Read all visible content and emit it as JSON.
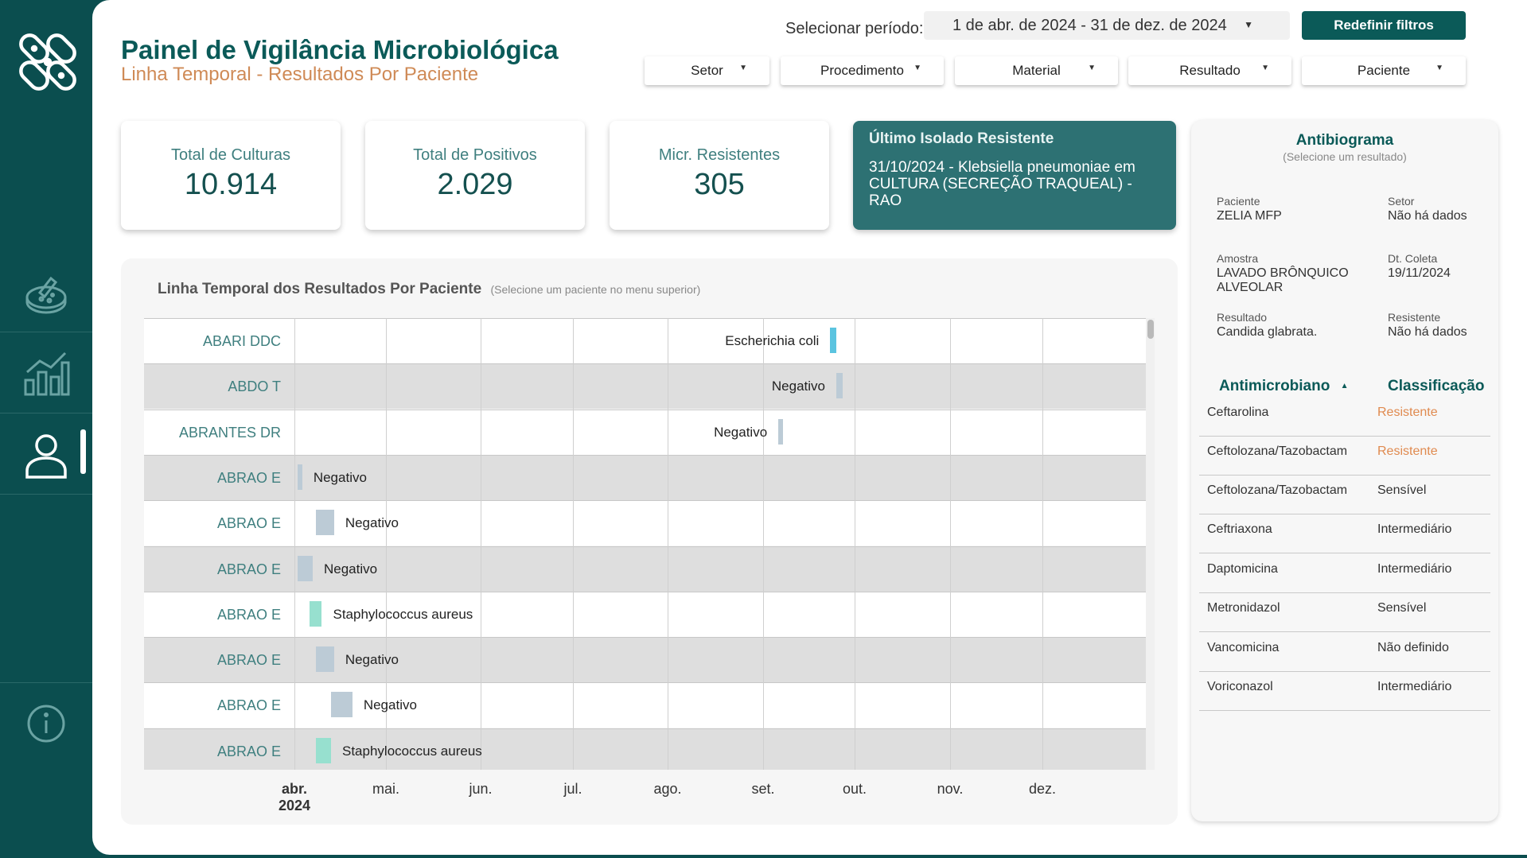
{
  "sidebar": {
    "logo_icon": "bacteria-icon",
    "nav": [
      {
        "name": "petri-dish-icon"
      },
      {
        "name": "chart-icon"
      },
      {
        "name": "user-icon",
        "active": true
      }
    ],
    "info_icon": "info-icon"
  },
  "header": {
    "title": "Painel de Vigilância Microbiológica",
    "subtitle": "Linha Temporal - Resultados Por Paciente",
    "period_label": "Selecionar período:",
    "period_value": "1 de abr. de 2024 - 31 de dez. de 2024",
    "reset_label": "Redefinir filtros",
    "filters": [
      "Setor",
      "Procedimento",
      "Material",
      "Resultado",
      "Paciente"
    ]
  },
  "kpis": [
    {
      "label": "Total de Culturas",
      "value": "10.914"
    },
    {
      "label": "Total de Positivos",
      "value": "2.029"
    },
    {
      "label": "Micr. Resistentes",
      "value": "305"
    }
  ],
  "last_isolate": {
    "title": "Último Isolado Resistente",
    "text": "31/10/2024 - Klebsiella pneumoniae em CULTURA (SECREÇÃO TRAQUEAL) - RAO"
  },
  "timeline": {
    "title": "Linha Temporal dos Resultados Por Paciente",
    "hint": "(Selecione um paciente no menu superior)",
    "months": [
      "abr.",
      "mai.",
      "jun.",
      "jul.",
      "ago.",
      "set.",
      "out.",
      "nov.",
      "dez."
    ],
    "year": "2024",
    "rows": [
      {
        "patient": "ABARI DDC",
        "result": "Escherichia coli",
        "start": "2024-09-23",
        "end": "2024-09-25",
        "color": "#5bc4e0"
      },
      {
        "patient": "ABDO T",
        "result": "Negativo",
        "start": "2024-09-25",
        "end": "2024-09-27",
        "color": "#bccbd6"
      },
      {
        "patient": "ABRANTES DR",
        "result": "Negativo",
        "start": "2024-09-06",
        "end": "2024-09-07",
        "color": "#bccbd6"
      },
      {
        "patient": "ABRAO E",
        "result": "Negativo",
        "start": "2024-04-02",
        "end": "2024-04-03",
        "color": "#bccbd6"
      },
      {
        "patient": "ABRAO E",
        "result": "Negativo",
        "start": "2024-04-08",
        "end": "2024-04-14",
        "color": "#bccbd6"
      },
      {
        "patient": "ABRAO E",
        "result": "Negativo",
        "start": "2024-04-02",
        "end": "2024-04-07",
        "color": "#bccbd6"
      },
      {
        "patient": "ABRAO E",
        "result": "Staphylococcus aureus",
        "start": "2024-04-06",
        "end": "2024-04-10",
        "color": "#97e0cf"
      },
      {
        "patient": "ABRAO E",
        "result": "Negativo",
        "start": "2024-04-08",
        "end": "2024-04-14",
        "color": "#bccbd6"
      },
      {
        "patient": "ABRAO E",
        "result": "Negativo",
        "start": "2024-04-13",
        "end": "2024-04-20",
        "color": "#bccbd6"
      },
      {
        "patient": "ABRAO E",
        "result": "Staphylococcus aureus",
        "start": "2024-04-08",
        "end": "2024-04-13",
        "color": "#97e0cf"
      }
    ]
  },
  "antibiogram": {
    "title": "Antibiograma",
    "subtitle": "(Selecione um resultado)",
    "fields": [
      {
        "key": "Paciente",
        "value": "ZELIA MFP"
      },
      {
        "key": "Setor",
        "value": "Não há dados"
      },
      {
        "key": "Amostra",
        "value": "LAVADO BRÔNQUICO ALVEOLAR"
      },
      {
        "key": "Dt. Coleta",
        "value": "19/11/2024"
      },
      {
        "key": "Resultado",
        "value": "Candida glabrata."
      },
      {
        "key": "Resistente",
        "value": "Não há dados"
      }
    ],
    "col_antimicrobial": "Antimicrobiano",
    "col_class": "Classificação",
    "resistant_color": "#e08a4f",
    "rows": [
      {
        "name": "Ceftarolina",
        "class": "Resistente"
      },
      {
        "name": "Ceftolozana/Tazobactam",
        "class": "Resistente"
      },
      {
        "name": "Ceftolozana/Tazobactam",
        "class": "Sensível"
      },
      {
        "name": "Ceftriaxona",
        "class": "Intermediário"
      },
      {
        "name": "Daptomicina",
        "class": "Intermediário"
      },
      {
        "name": "Metronidazol",
        "class": "Sensível"
      },
      {
        "name": "Vancomicina",
        "class": "Não definido"
      },
      {
        "name": "Voriconazol",
        "class": "Intermediário"
      }
    ]
  }
}
